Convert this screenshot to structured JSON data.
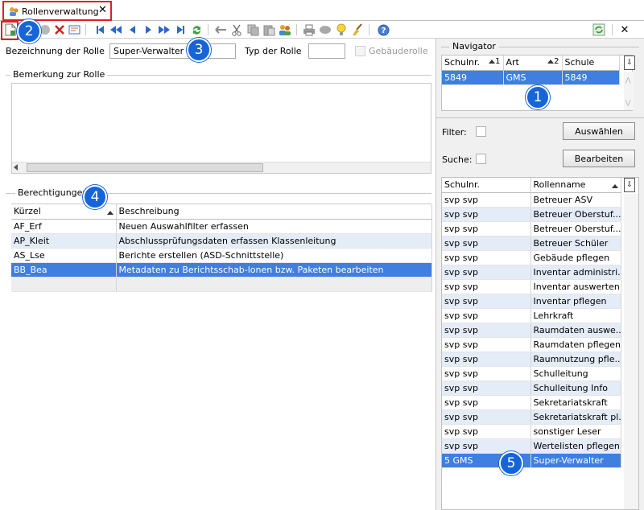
{
  "tab": {
    "title": "Rollenverwaltung",
    "close": "✕"
  },
  "toolbar": {
    "close_label": "✕"
  },
  "form": {
    "role_name_label": "Bezeichnung der Rolle",
    "role_name_value": "Super-Verwalter",
    "role_type_label": "Typ der Rolle",
    "role_type_value": "",
    "building_role_label": "Gebäuderolle",
    "remark_group": "Bemerkung zur Rolle",
    "permissions_group": "Berechtigungen"
  },
  "permissions": {
    "columns": [
      "Kürzel",
      "Beschreibung"
    ],
    "rows": [
      [
        "AF_Erf",
        "Neuen Auswahlfilter erfassen"
      ],
      [
        "AP_Kleit",
        "Abschlussprüfungsdaten erfassen Klassenleitung"
      ],
      [
        "AS_Lse",
        "Berichte erstellen (ASD-Schnittstelle)"
      ],
      [
        "BB_Bea",
        "Metadaten zu Berichtsschab-lonen bzw. Paketen bearbeiten"
      ]
    ]
  },
  "navigator": {
    "title": "Navigator",
    "columns": [
      "Schulnr.",
      "Art",
      "Schule"
    ],
    "sort_marks": [
      "1",
      "2"
    ],
    "rows": [
      [
        "5849",
        "GMS",
        "5849"
      ]
    ],
    "filter_label": "Filter:",
    "search_label": "Suche:",
    "select_button": "Auswählen",
    "edit_button": "Bearbeiten"
  },
  "roles": {
    "columns": [
      "Schulnr.",
      "Rollenname"
    ],
    "rows": [
      [
        "svp svp",
        "Betreuer ASV"
      ],
      [
        "svp svp",
        "Betreuer Oberstuf..."
      ],
      [
        "svp svp",
        "Betreuer Oberstuf..."
      ],
      [
        "svp svp",
        "Betreuer Schüler"
      ],
      [
        "svp svp",
        "Gebäude pflegen"
      ],
      [
        "svp svp",
        "Inventar administri..."
      ],
      [
        "svp svp",
        "Inventar auswerten"
      ],
      [
        "svp svp",
        "Inventar pflegen"
      ],
      [
        "svp svp",
        "Lehrkraft"
      ],
      [
        "svp svp",
        "Raumdaten auswe..."
      ],
      [
        "svp svp",
        "Raumdaten pflegen"
      ],
      [
        "svp svp",
        "Raumnutzung pfle..."
      ],
      [
        "svp svp",
        "Schulleitung"
      ],
      [
        "svp svp",
        "Schulleitung Info"
      ],
      [
        "svp svp",
        "Sekretariatskraft"
      ],
      [
        "svp svp",
        "Sekretariatskraft pl..."
      ],
      [
        "svp svp",
        "sonstiger Leser"
      ],
      [
        "svp svp",
        "Wertelisten pflegen"
      ],
      [
        "5 GMS",
        "Super-Verwalter"
      ]
    ]
  },
  "badges": [
    "1",
    "2",
    "3",
    "4",
    "5"
  ],
  "colors": {
    "selection": "#3e7fe0",
    "alt_row": "#e4ecf8",
    "badge": "#1565d8",
    "highlight_box": "#e02020"
  }
}
